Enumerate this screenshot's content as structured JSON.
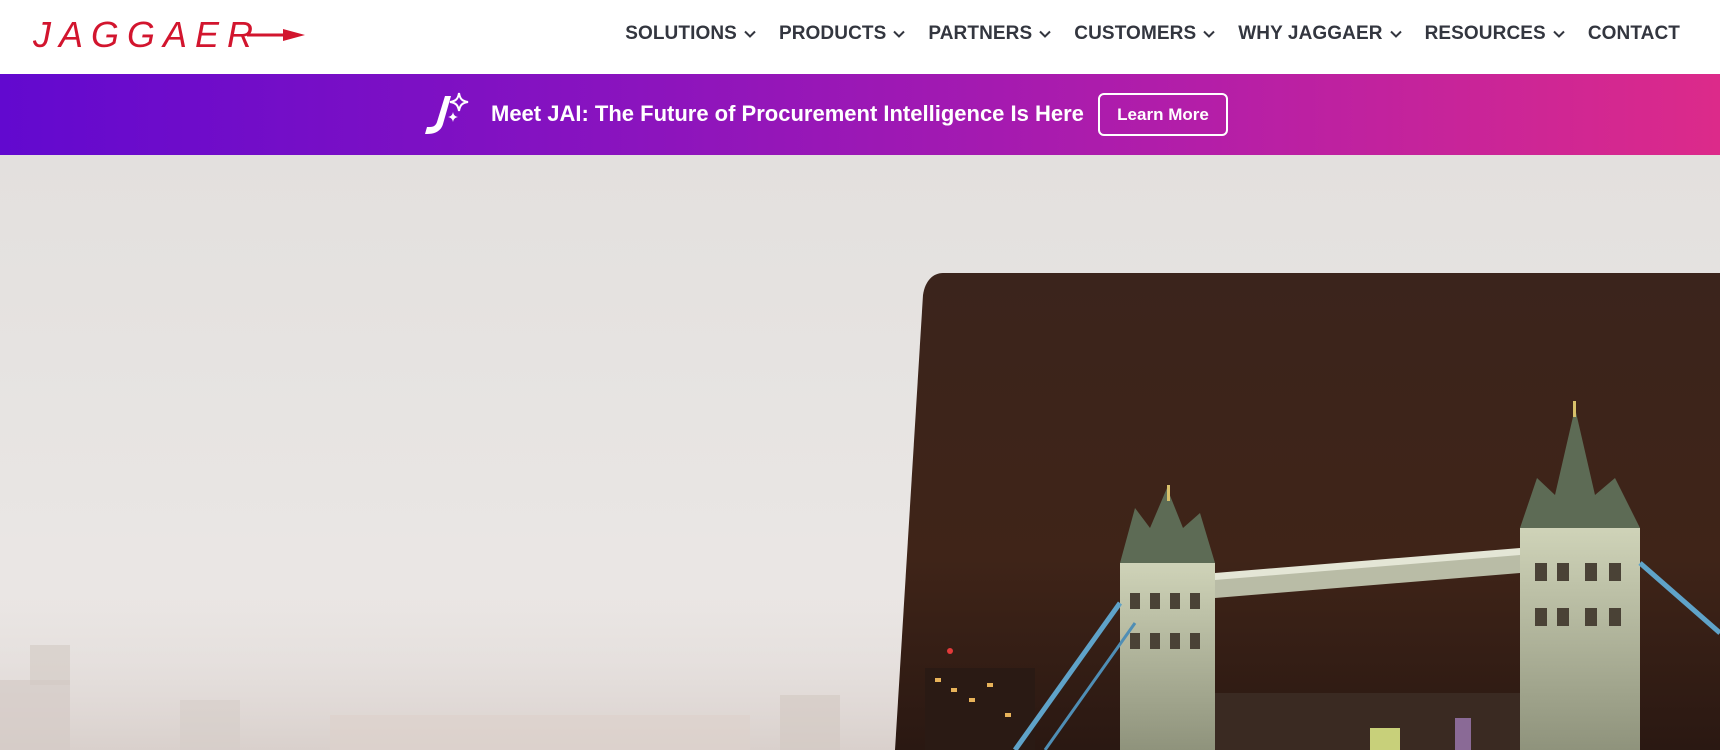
{
  "header": {
    "logo_text": "JAGGAER",
    "nav": [
      {
        "label": "SOLUTIONS",
        "has_dropdown": true
      },
      {
        "label": "PRODUCTS",
        "has_dropdown": true
      },
      {
        "label": "PARTNERS",
        "has_dropdown": true
      },
      {
        "label": "CUSTOMERS",
        "has_dropdown": true
      },
      {
        "label": "WHY JAGGAER",
        "has_dropdown": true
      },
      {
        "label": "RESOURCES",
        "has_dropdown": true
      },
      {
        "label": "CONTACT",
        "has_dropdown": false
      }
    ]
  },
  "banner": {
    "icon": "jai-sparkle-icon",
    "text": "Meet JAI: The Future of Procurement Intelligence Is Here",
    "button_label": "Learn More",
    "gradient_start": "#6209cf",
    "gradient_end": "#dc2a8a"
  },
  "hero": {
    "image": "tower-bridge-night-photo"
  },
  "colors": {
    "brand_red": "#d2152e",
    "nav_text": "#33363f"
  }
}
